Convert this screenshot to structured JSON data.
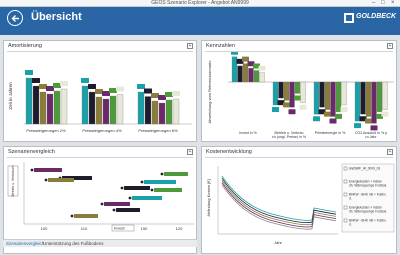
{
  "window": {
    "title": "GEOS Szenario Explorer - Angebot AN9999",
    "minimize": "–",
    "maximize": "□",
    "close": "×"
  },
  "header": {
    "title": "Übersicht",
    "brand": "GOLDBECK"
  },
  "colors": {
    "header": "#2a66a6",
    "teal": "#1aa0a8",
    "dark": "#1c1c2a",
    "olive": "#8a7c3a",
    "purple": "#6a2a6a",
    "green": "#4c9a3a"
  },
  "panels": {
    "amortisierung": {
      "title": "Amortisierung",
      "ylabel": "Zeit in Jahren",
      "groups": [
        "Preissteigerungen 2%",
        "Preissteigerungen 4%",
        "Preissteigerungen 6%"
      ],
      "values": [
        [
          9.2,
          7.6,
          6.4,
          6.0,
          6.6,
          7.0
        ],
        [
          7.6,
          6.4,
          5.4,
          5.0,
          5.6,
          5.9
        ],
        [
          6.4,
          5.5,
          4.6,
          4.2,
          4.8,
          5.0
        ]
      ],
      "series_colors": [
        "#1aa0a8",
        "#1c1c2a",
        "#8a7c3a",
        "#6a2a6a",
        "#4c9a3a",
        "#e8e8d8"
      ]
    },
    "kennzahlen": {
      "title": "Kennzahlen",
      "ylabel": "Abweichung vom Referenzszenario",
      "groups": [
        "Invest in %",
        "Betrieb u. Verbrauch (ungl. Preise) in %",
        "Primärenergie in %",
        "CO2 Ausstoß in % pro Jahr"
      ],
      "values": [
        [
          22,
          14,
          16,
          12,
          10,
          8
        ],
        [
          -20,
          -14,
          -16,
          -22,
          -10,
          -18
        ],
        [
          -28,
          -22,
          -24,
          -30,
          -26,
          -20
        ],
        [
          -34,
          -28,
          -30,
          -36,
          -26,
          -24
        ]
      ],
      "series_colors": [
        "#1aa0a8",
        "#1c1c2a",
        "#8a7c3a",
        "#6a2a6a",
        "#4c9a3a",
        "#e8e8d8"
      ]
    },
    "szenarienvergleich": {
      "title": "Szenarienvergleich",
      "axis_select": "Betrieb u. Verbrauch",
      "x_select": "Invest",
      "xticks": [
        "100",
        "110",
        "150",
        "120"
      ]
    },
    "kostenentwicklung": {
      "title": "Kostenentwicklung",
      "ylabel": "Abfindung Kosten [€]",
      "xlabel": "Jahr",
      "legend": [
        "ändSMF_Ht_0000_03",
        "Energiekosten + Instandh. Wärmepumpe Fußbod.",
        "BHKW - BHK mit + Fußbod.",
        "Energiekosten + Instandh. Wärmepumpe Fußbod.",
        "BHKW - BHK mit + Fußbod."
      ]
    }
  },
  "footer": {
    "tab1": "Szenarienvergleich",
    "tab2": "Unterstützung des Fußbodens"
  }
}
